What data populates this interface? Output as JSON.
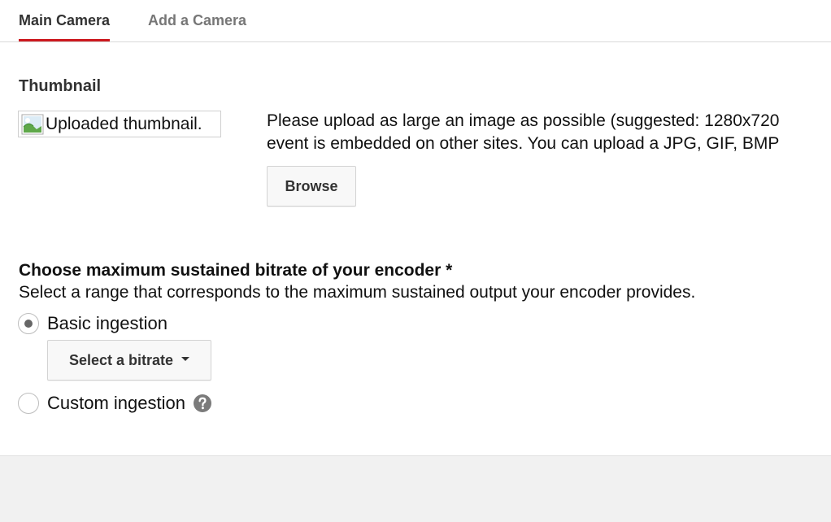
{
  "tabs": [
    {
      "label": "Main Camera",
      "active": true
    },
    {
      "label": "Add a Camera",
      "active": false
    }
  ],
  "thumbnail": {
    "heading": "Thumbnail",
    "image_alt": "Uploaded thumbnail.",
    "description_lines": [
      "Please upload as large an image as possible (suggested: 1280x720",
      "event is embedded on other sites. You can upload a JPG, GIF, BMP"
    ],
    "browse_label": "Browse"
  },
  "bitrate": {
    "heading": "Choose maximum sustained bitrate of your encoder *",
    "description": "Select a range that corresponds to the maximum sustained output your encoder provides.",
    "options": [
      {
        "label": "Basic ingestion",
        "selected": true
      },
      {
        "label": "Custom ingestion",
        "selected": false
      }
    ],
    "select_label": "Select a bitrate"
  },
  "colors": {
    "active_tab_underline": "#cc181e",
    "inactive_tab_text": "#777777",
    "footer_background": "#f1f1f1"
  },
  "icons": {
    "broken_image": "broken-image-icon",
    "help": "question-mark-help-icon",
    "dropdown": "caret-down-icon"
  }
}
